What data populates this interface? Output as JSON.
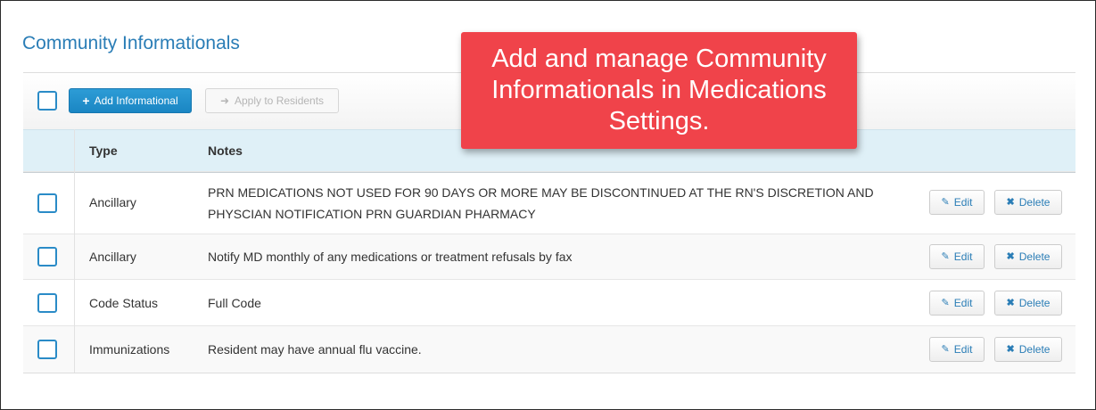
{
  "page": {
    "title": "Community Informationals"
  },
  "toolbar": {
    "add_label": "Add Informational",
    "apply_label": "Apply to Residents"
  },
  "table": {
    "headers": [
      "Type",
      "Notes"
    ],
    "rows": [
      {
        "type": "Ancillary",
        "notes": "PRN MEDICATIONS NOT USED FOR 90 DAYS OR MORE MAY BE DISCONTINUED AT THE RN'S DISCRETION AND PHYSCIAN NOTIFICATION PRN GUARDIAN PHARMACY",
        "edit": "Edit",
        "delete": "Delete"
      },
      {
        "type": "Ancillary",
        "notes": "Notify MD monthly of any medications or treatment refusals by fax",
        "edit": "Edit",
        "delete": "Delete"
      },
      {
        "type": "Code Status",
        "notes": "Full Code",
        "edit": "Edit",
        "delete": "Delete"
      },
      {
        "type": "Immunizations",
        "notes": "Resident may have annual flu vaccine.",
        "edit": "Edit",
        "delete": "Delete"
      }
    ]
  },
  "callout": {
    "text": "Add and manage Community Informationals in Medications Settings."
  },
  "colors": {
    "accent": "#2a7db6",
    "primary_button": "#1a86c3",
    "header_bg": "#dff0f7",
    "callout_bg": "#f0434a"
  },
  "icons": {
    "add": "plus-icon",
    "apply": "arrow-right-icon",
    "edit": "pencil-icon",
    "delete": "x-icon"
  }
}
